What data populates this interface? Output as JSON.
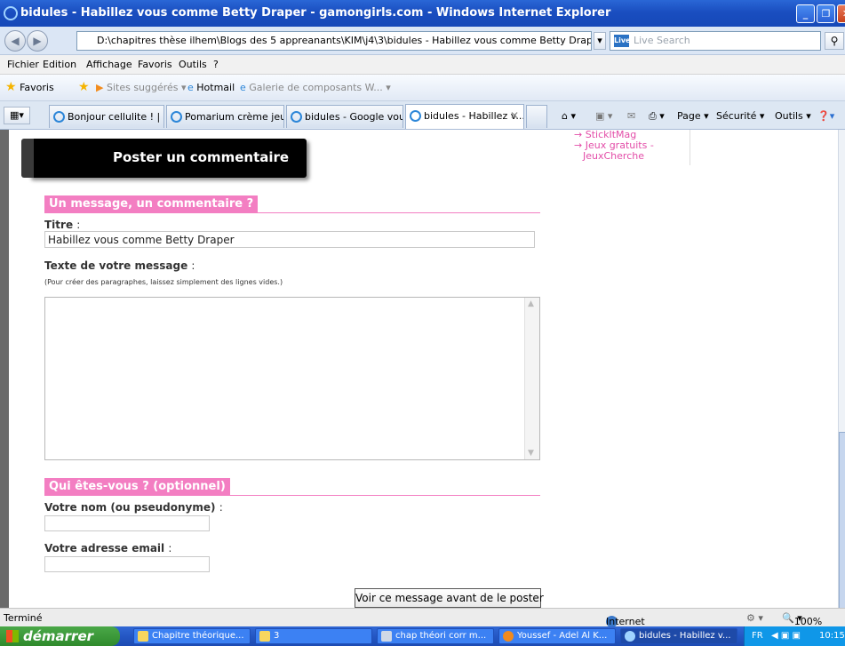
{
  "window": {
    "title": "bidules - Habillez vous comme Betty Draper - gamongirls.com - Windows Internet Explorer"
  },
  "address_bar": {
    "url": "D:\\chapitres thèse ilhem\\Blogs des 5 appreanants\\KIM\\j4\\3\\bidules - Habillez vous comme Betty Draper - gamon",
    "search_placeholder": "Live Search",
    "search_brand": "Live"
  },
  "menu": [
    "Fichier",
    "Edition",
    "Affichage",
    "Favoris",
    "Outils",
    "?"
  ],
  "favorites_bar": {
    "favoris": "Favoris",
    "sites": "Sites suggérés ▾",
    "hotmail": "Hotmail",
    "galerie": "Galerie de composants W... ▾"
  },
  "tabs": [
    {
      "label": "Bonjour cellulite ! | SO..."
    },
    {
      "label": "Pomarium crème jeun..."
    },
    {
      "label": "bidules - Google vous ..."
    },
    {
      "label": "bidules - Habillez v..."
    }
  ],
  "command_bar": {
    "page": "Page ▾",
    "securite": "Sécurité ▾",
    "outils": "Outils ▾"
  },
  "sidebar_links": [
    "→ StickItMag",
    "→ Jeux gratuits -",
    "JeuxCherche"
  ],
  "post": {
    "header": "Poster un commentaire",
    "section1": "Un message, un commentaire ?",
    "titre_label": "Titre",
    "titre_value": "Habillez vous comme Betty Draper",
    "message_label": "Texte de votre message",
    "message_hint": "(Pour créer des paragraphes, laissez simplement des lignes vides.)",
    "section2": "Qui êtes-vous ? (optionnel)",
    "nom_label": "Votre nom (ou pseudonyme)",
    "email_label": "Votre adresse email",
    "submit": "Voir ce message avant de le poster",
    "colon": ":"
  },
  "status_bar": {
    "status": "Terminé",
    "zone": "Internet",
    "zoom": "100%"
  },
  "taskbar": {
    "start": "démarrer",
    "items": [
      {
        "label": "Chapitre théorique..."
      },
      {
        "label": "3"
      },
      {
        "label": "chap théori corr m..."
      },
      {
        "label": "Youssef - Adel Al K..."
      },
      {
        "label": "bidules - Habillez v..."
      }
    ],
    "lang": "FR",
    "clock": "10:15"
  }
}
